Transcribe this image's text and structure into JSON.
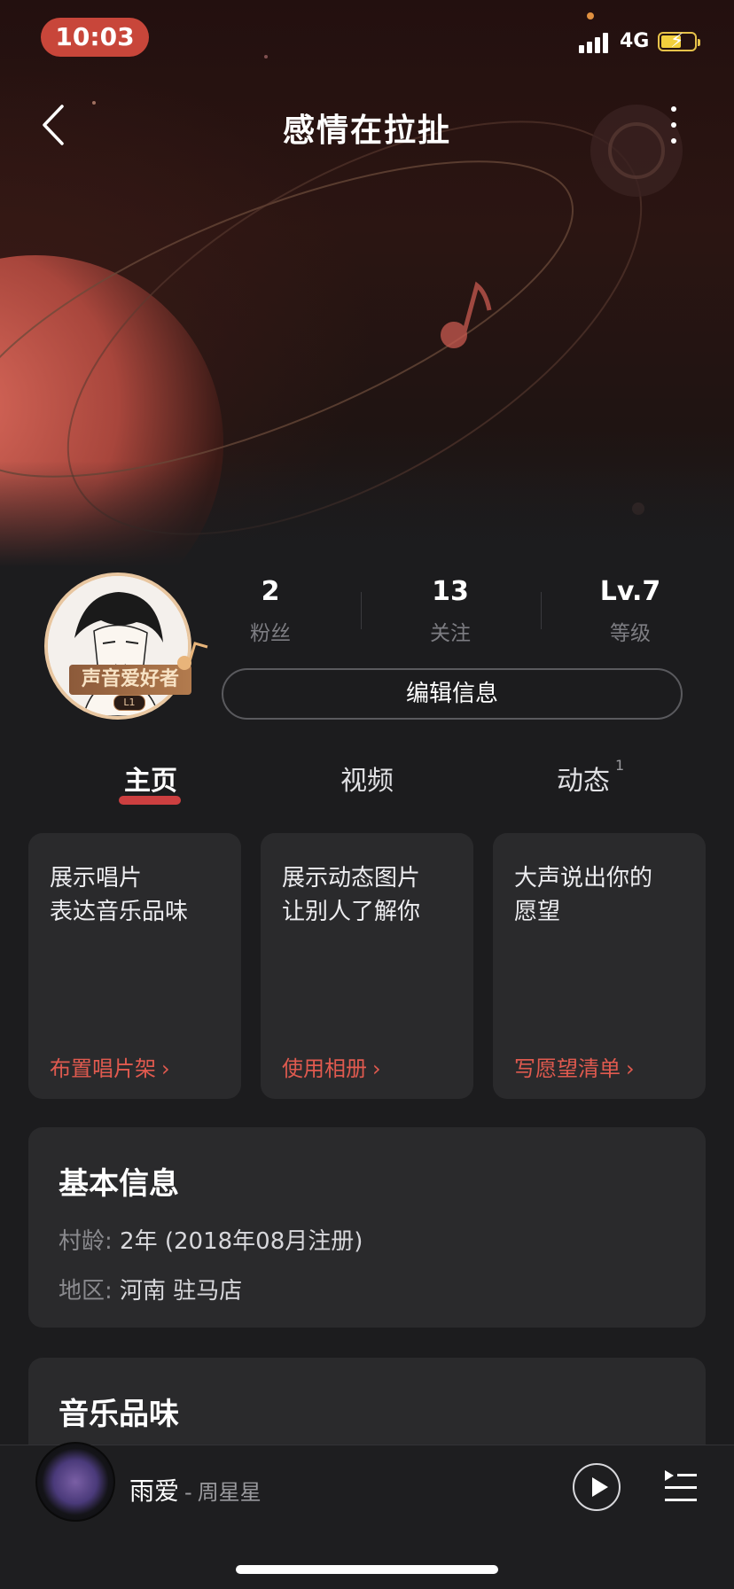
{
  "status_bar": {
    "time": "10:03",
    "network": "4G"
  },
  "nav": {
    "title": "感情在拉扯"
  },
  "profile": {
    "badge_text": "声音爱好者",
    "badge_level": "L1",
    "stats": [
      {
        "value": "2",
        "label": "粉丝"
      },
      {
        "value": "13",
        "label": "关注"
      },
      {
        "value": "Lv.7",
        "label": "等级"
      }
    ],
    "edit_button": "编辑信息"
  },
  "tabs": [
    {
      "label": "主页",
      "active": true
    },
    {
      "label": "视频",
      "active": false
    },
    {
      "label": "动态",
      "count": "1",
      "active": false
    }
  ],
  "cards": [
    {
      "line1": "展示唱片",
      "line2": "表达音乐品味",
      "action": "布置唱片架"
    },
    {
      "line1": "展示动态图片",
      "line2": "让别人了解你",
      "action": "使用相册"
    },
    {
      "line1": "大声说出你的",
      "line2": "愿望",
      "action": "写愿望清单"
    }
  ],
  "basic_info": {
    "title": "基本信息",
    "age_label": "村龄:",
    "age_value": "2年 (2018年08月注册)",
    "region_label": "地区:",
    "region_value": "河南 驻马店"
  },
  "music_taste": {
    "title": "音乐品味"
  },
  "player": {
    "song": "雨爱",
    "separator": "-",
    "artist": "周星星"
  },
  "colors": {
    "accent": "#e05a4f",
    "time_pill": "#c8463a",
    "background": "#1c1c1e",
    "card": "#2a2a2c"
  }
}
